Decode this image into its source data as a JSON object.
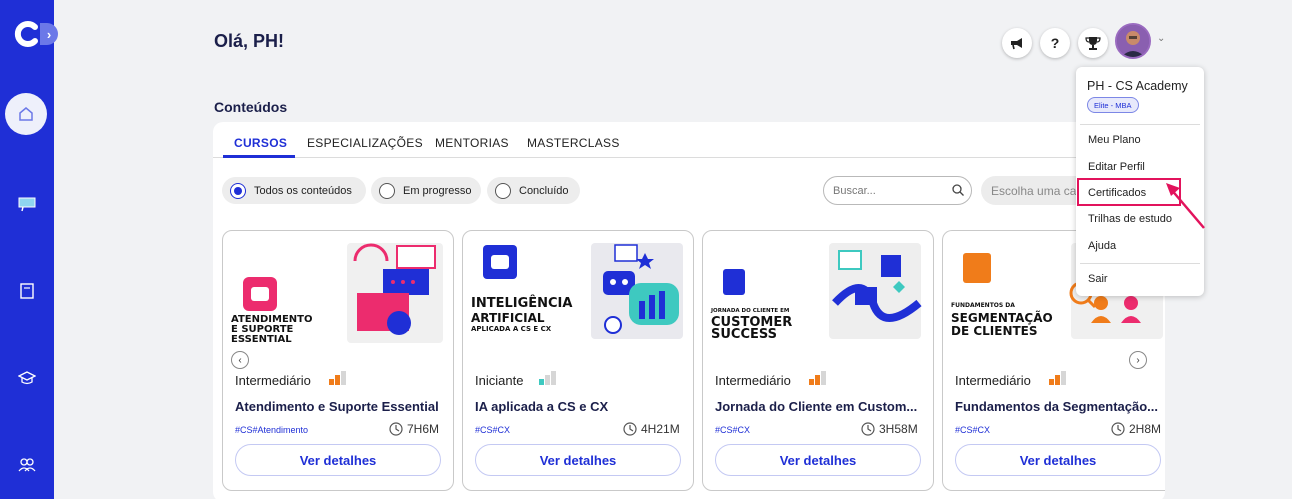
{
  "header": {
    "greeting": "Olá, PH!",
    "section_title": "Conteúdos",
    "help_label": "?",
    "icons": [
      "megaphone-icon",
      "help-icon",
      "trophy-icon",
      "avatar",
      "chevron-down-icon"
    ]
  },
  "sidebar": {
    "toggle_label": "›",
    "icons": [
      "logo-icon",
      "home-icon",
      "ticket-icon",
      "book-icon",
      "graduation-cap-icon",
      "community-icon"
    ]
  },
  "tabs": [
    "CURSOS",
    "ESPECIALIZAÇÕES",
    "MENTORIAS",
    "MASTERCLASS"
  ],
  "active_tab": "CURSOS",
  "filters": {
    "options": [
      "Todos os conteúdos",
      "Em progresso",
      "Concluído"
    ],
    "selected": "Todos os conteúdos",
    "search_placeholder": "Buscar...",
    "category_placeholder": "Escolha uma ca"
  },
  "cards": [
    {
      "art_title": [
        "ATENDIMENTO",
        "E SUPORTE",
        "ESSENTIAL"
      ],
      "level": "Intermediário",
      "level_color": "#f07c1a",
      "title": "Atendimento e Suporte Essential",
      "tags": "#CS#Atendimento",
      "duration": "7H6M",
      "button": "Ver detalhes"
    },
    {
      "art_title": [
        "INTELIGÊNCIA",
        "ARTIFICIAL",
        "APLICADA A CS E CX"
      ],
      "level": "Iniciante",
      "level_color": "#3ec9c0",
      "title": "IA aplicada a CS e CX",
      "tags": "#CS#CX",
      "duration": "4H21M",
      "button": "Ver detalhes"
    },
    {
      "art_title": [
        "JORNADA DO CLIENTE EM",
        "CUSTOMER",
        "SUCCESS"
      ],
      "level": "Intermediário",
      "level_color": "#f07c1a",
      "title": "Jornada do Cliente em Custom...",
      "tags": "#CS#CX",
      "duration": "3H58M",
      "button": "Ver detalhes"
    },
    {
      "art_title": [
        "FUNDAMENTOS DA",
        "SEGMENTAÇÃO",
        "DE CLIENTES"
      ],
      "level": "Intermediário",
      "level_color": "#f07c1a",
      "title": "Fundamentos da Segmentação...",
      "tags": "#CS#CX",
      "duration": "2H8M",
      "button": "Ver detalhes"
    }
  ],
  "carousel": {
    "prev": "‹",
    "next": "›"
  },
  "user_menu": {
    "name": "PH - CS Academy",
    "badge": "Elite - MBA",
    "items": [
      "Meu Plano",
      "Editar Perfil",
      "Certificados",
      "Trilhas de estudo",
      "Ajuda"
    ],
    "logout": "Sair",
    "highlighted": "Certificados",
    "highlight_color": "#e2135c"
  },
  "colors": {
    "brand": "#1f2fd6",
    "accent_pink": "#ec2c6e",
    "orange": "#f07c1a",
    "teal": "#3ec9c0"
  }
}
